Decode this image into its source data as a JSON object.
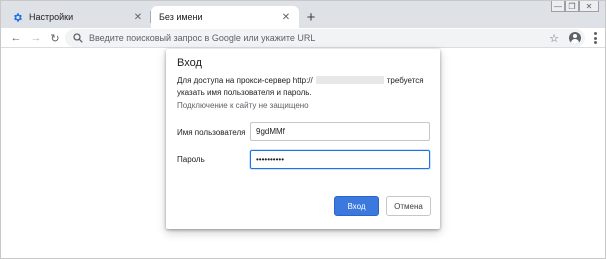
{
  "window": {
    "controls": {
      "minimize": "—",
      "maximize": "❐",
      "close": "✕"
    }
  },
  "tabs": [
    {
      "title": "Настройки",
      "icon": "gear-icon",
      "active": false
    },
    {
      "title": "Без имени",
      "icon": "",
      "active": true
    }
  ],
  "tab_close_glyph": "✕",
  "new_tab_glyph": "+",
  "toolbar": {
    "back_glyph": "←",
    "forward_glyph": "→",
    "reload_glyph": "↻",
    "omnibox_placeholder": "Введите поисковый запрос в Google или укажите URL",
    "star_glyph": "☆"
  },
  "auth_dialog": {
    "title": "Вход",
    "message_prefix": "Для доступа на прокси-сервер http://",
    "message_suffix": "требуется",
    "message_line2": "указать имя пользователя и пароль.",
    "warning": "Подключение к сайту не защищено",
    "username_label": "Имя пользователя",
    "username_value": "9gdMMf",
    "password_label": "Пароль",
    "password_value": "••••••••••",
    "submit_label": "Вход",
    "cancel_label": "Отмена"
  },
  "colors": {
    "tabstrip": "#dee1e6",
    "primary_button": "#3b79de",
    "focus": "#1a73e8"
  }
}
